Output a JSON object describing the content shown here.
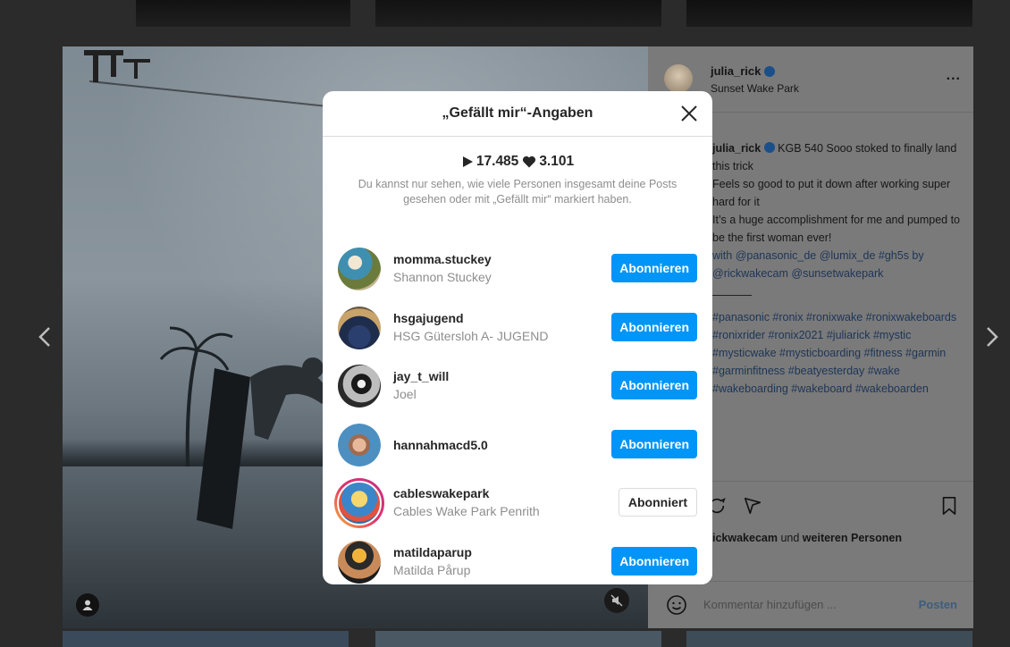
{
  "modal": {
    "title": "„Gefällt mir“-Angaben",
    "views": "17.485",
    "likes": "3.101",
    "note": "Du kannst nur sehen, wie viele Personen insgesamt deine Posts gesehen oder mit „Gefällt mir“ markiert haben.",
    "users": [
      {
        "username": "momma.stuckey",
        "full_name": "Shannon Stuckey",
        "button": "Abonnieren",
        "following": false
      },
      {
        "username": "hsgajugend",
        "full_name": "HSG Gütersloh A- JUGEND",
        "button": "Abonnieren",
        "following": false
      },
      {
        "username": "jay_t_will",
        "full_name": "Joel",
        "button": "Abonnieren",
        "following": false
      },
      {
        "username": "hannahmacd5.0",
        "full_name": "",
        "button": "Abonnieren",
        "following": false
      },
      {
        "username": "cableswakepark",
        "full_name": "Cables Wake Park Penrith",
        "button": "Abonniert",
        "following": true
      },
      {
        "username": "matildaparup",
        "full_name": "Matilda Pårup",
        "button": "Abonnieren",
        "following": false
      }
    ]
  },
  "post": {
    "username": "julia_rick",
    "location": "Sunset Wake Park",
    "more": "...",
    "caption_lines": [
      "KGB 540",
      "Sooo stoked to finally land this trick",
      "Feels so good to put it down after working super hard for it",
      "It’s a huge accomplishment for me and pumped to be the first woman ever!",
      "with @panasonic_de @lumix_de #gh5s by @rickwakecam @sunsetwakepark"
    ],
    "hashtags": "#panasonic #ronix #ronixwake #ronixwakeboards #ronixrider #ronix2021 #juliarick #mystic #mysticwake #mysticboarding #fitness #garmin #garminfitness #beatyesterday #wake #wakeboarding #wakeboard #wakeboarden",
    "likes_prefix": "ickwakecam",
    "likes_mid": " und ",
    "likes_suffix": "weiteren Personen",
    "comment_placeholder": "Kommentar hinzufügen ...",
    "post_button": "Posten"
  },
  "colors": {
    "accent": "#0095f6",
    "muted_text": "#8e8e8e",
    "border": "#dbdbdb"
  }
}
